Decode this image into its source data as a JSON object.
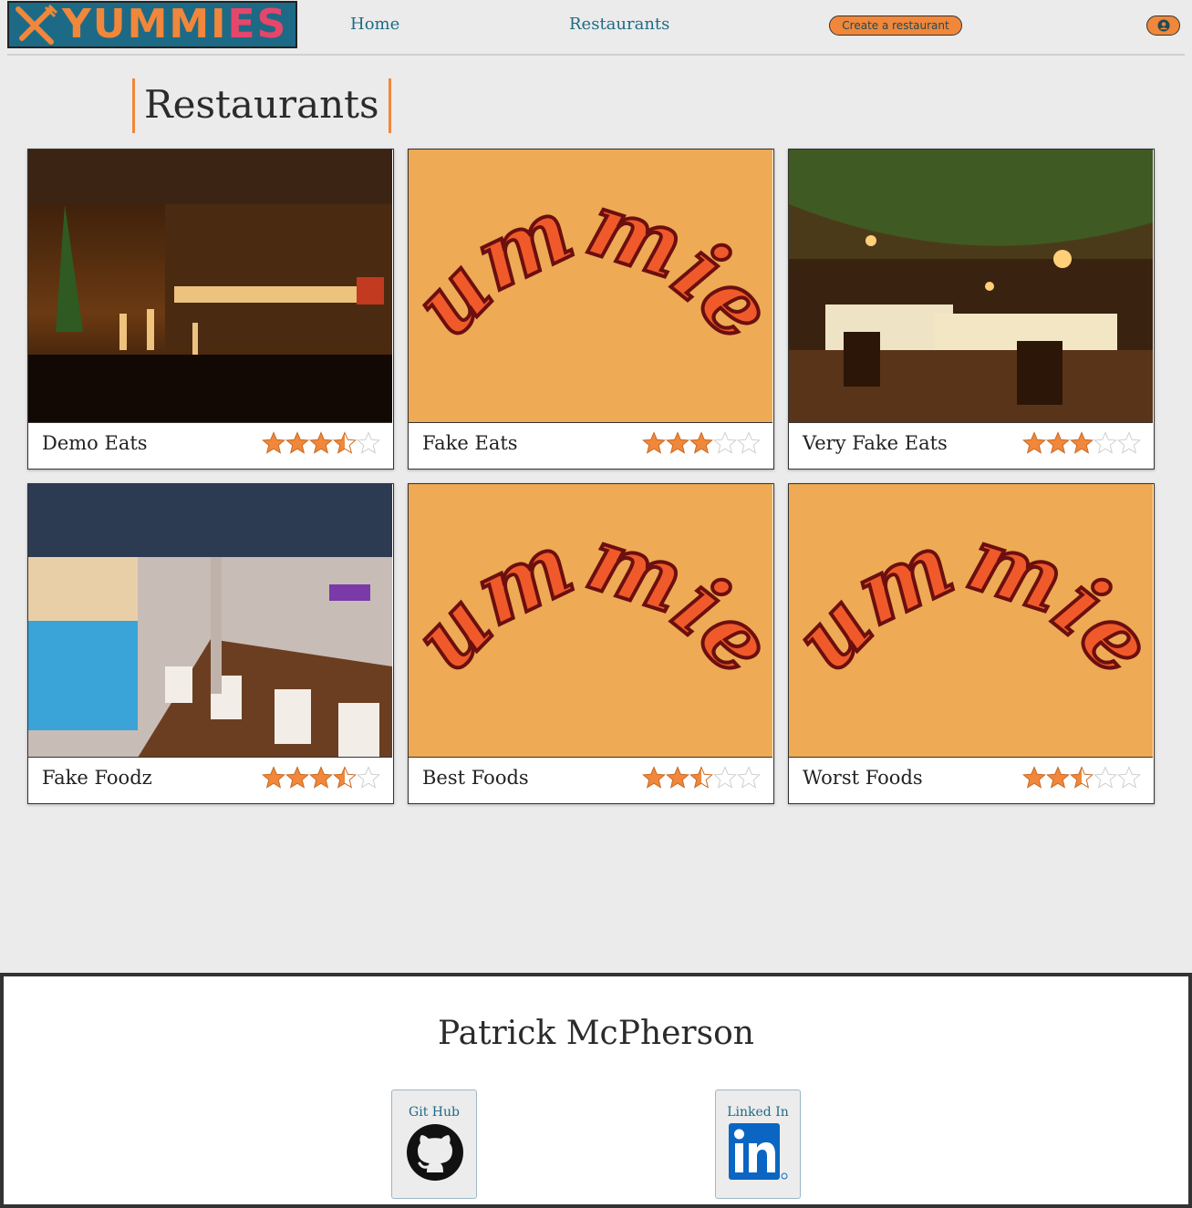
{
  "header": {
    "logo_text_a": "YUMMI",
    "logo_text_b": "ES",
    "nav": {
      "home": "Home",
      "restaurants": "Restaurants"
    },
    "create_label": "Create a restaurant",
    "user_icon": "user-icon"
  },
  "page": {
    "title": "Restaurants"
  },
  "restaurants": [
    {
      "name": "Demo Eats",
      "rating": 3.5,
      "image": "bar-interior-photo"
    },
    {
      "name": "Fake Eats",
      "rating": 3,
      "image": "yummies-placeholder"
    },
    {
      "name": "Very Fake Eats",
      "rating": 3,
      "image": "garden-restaurant-photo"
    },
    {
      "name": "Fake Foodz",
      "rating": 3.5,
      "image": "poolside-restaurant-photo"
    },
    {
      "name": "Best Foods",
      "rating": 2.5,
      "image": "yummies-placeholder"
    },
    {
      "name": "Worst Foods",
      "rating": 2.5,
      "image": "yummies-placeholder"
    }
  ],
  "placeholder_text": "Yummies",
  "footer": {
    "name": "Patrick McPherson",
    "github_label": "Git Hub",
    "linkedin_label": "Linked In"
  },
  "colors": {
    "accent": "#f0873a",
    "brand_blue": "#1d6a86",
    "star": "#f0873a",
    "placeholder_bg": "#eeaa55",
    "placeholder_text": "#f05a2a"
  }
}
